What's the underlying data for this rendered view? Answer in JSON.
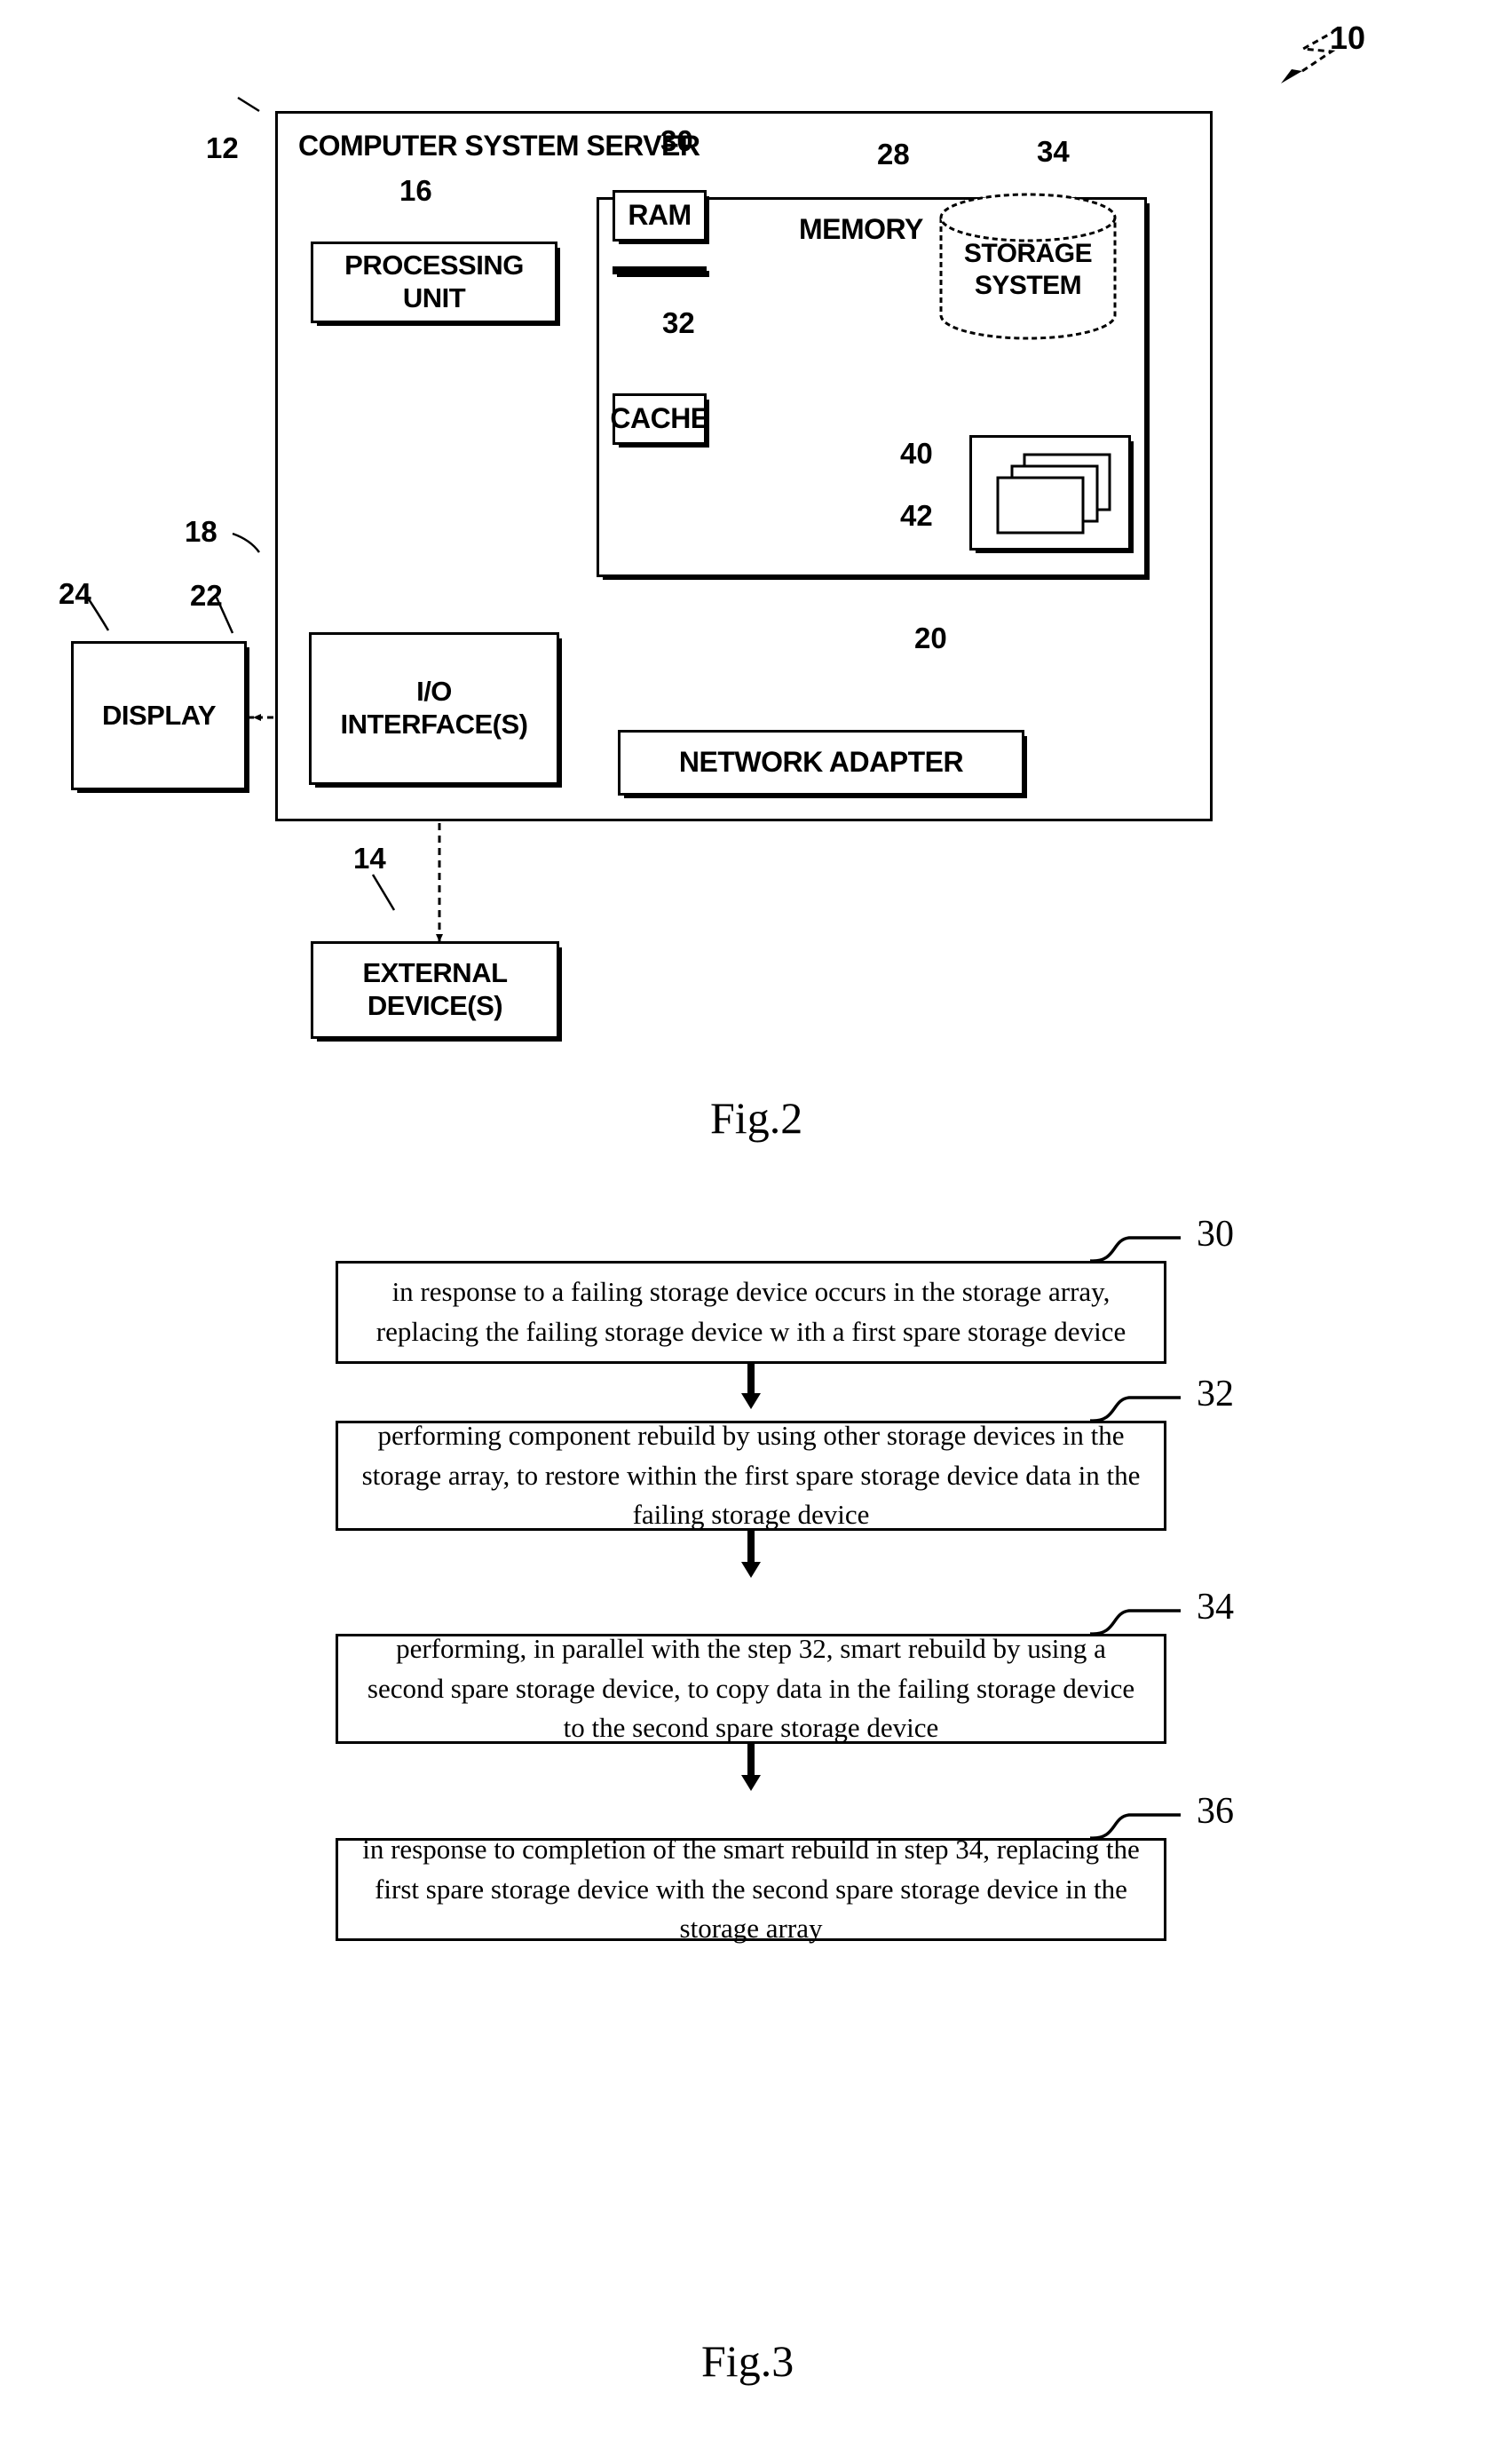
{
  "figure2": {
    "caption": "Fig.2",
    "system_ref": "10",
    "server": {
      "ref": "12",
      "title": "COMPUTER SYSTEM SERVER"
    },
    "memory": {
      "ref": "28",
      "title": "MEMORY"
    },
    "ram": {
      "ref": "30",
      "label": "RAM"
    },
    "cache": {
      "ref": "32",
      "label": "CACHE"
    },
    "storage_system": {
      "ref": "34",
      "label_line1": "STORAGE",
      "label_line2": "SYSTEM"
    },
    "program": {
      "ref": "40"
    },
    "program_modules": {
      "ref": "42"
    },
    "processing_unit": {
      "ref": "16",
      "label_line1": "PROCESSING",
      "label_line2": "UNIT"
    },
    "bus": {
      "ref": "18"
    },
    "io_interfaces": {
      "ref": "22",
      "label_line1": "I/O",
      "label_line2": "INTERFACE(S)"
    },
    "network_adapter": {
      "ref": "20",
      "label": "NETWORK ADAPTER"
    },
    "display": {
      "ref": "24",
      "label": "DISPLAY"
    },
    "external_devices": {
      "ref": "14",
      "label_line1": "EXTERNAL",
      "label_line2": "DEVICE(S)"
    }
  },
  "figure3": {
    "caption": "Fig.3",
    "steps": [
      {
        "ref": "30",
        "text": "in response to a failing storage device occurs in the storage array, replacing the failing storage device w ith a first spare storage device"
      },
      {
        "ref": "32",
        "text": "performing component rebuild by using other storage devices in the storage array, to restore within the first spare storage device data in the failing storage device"
      },
      {
        "ref": "34",
        "text": "performing, in parallel with the step 32, smart rebuild by using a second spare storage device, to copy data in the failing storage device to the second spare storage device"
      },
      {
        "ref": "36",
        "text": "in response to completion of the smart rebuild in step 34, replacing the first spare storage device with the second spare storage device in the storage array"
      }
    ]
  }
}
